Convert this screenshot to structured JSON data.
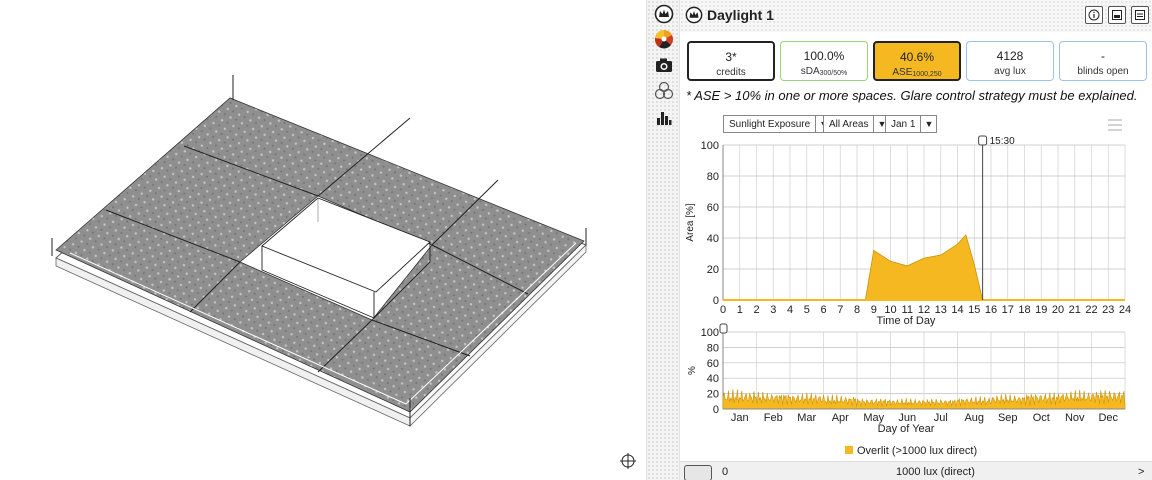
{
  "panel": {
    "title": "Daylight 1",
    "header_buttons": [
      "info-icon",
      "export-image-icon",
      "export-data-icon"
    ]
  },
  "sidebar": {
    "icons": [
      "daylight-logo-icon",
      "sun-rays-icon",
      "camera-icon",
      "shapes-icon",
      "bar-chart-icon"
    ]
  },
  "metrics": [
    {
      "value": "3*",
      "label": "credits",
      "border": "#222222",
      "bg": "#ffffff"
    },
    {
      "value": "100.0%",
      "label": "sDA",
      "sub": "300/50%",
      "border": "#9bd37a",
      "bg": "#ffffff"
    },
    {
      "value": "40.6%",
      "label": "ASE",
      "sub": "1000,250",
      "border": "#222222",
      "bg": "#f5b820"
    },
    {
      "value": "4128",
      "label": "avg lux",
      "border": "#9cc3e6",
      "bg": "#ffffff"
    },
    {
      "value": "-",
      "label": "blinds open",
      "border": "#9cc3e6",
      "bg": "#ffffff"
    }
  ],
  "note": "* ASE > 10% in one or more spaces. Glare control strategy must be explained.",
  "controls": {
    "metric_select": "Sunlight Exposure",
    "area_select": "All Areas",
    "date_select": "Jan 1"
  },
  "colors": {
    "accent": "#f5b820",
    "accent_dark": "#c8940a"
  },
  "chart_data": [
    {
      "type": "area",
      "ylabel": "Area [%]",
      "xlabel": "Time of Day",
      "xlim": [
        0,
        24
      ],
      "ylim": [
        0,
        100
      ],
      "yticks": [
        0,
        20,
        40,
        60,
        80,
        100
      ],
      "xticks": [
        0,
        1,
        2,
        3,
        4,
        5,
        6,
        7,
        8,
        9,
        10,
        11,
        12,
        13,
        14,
        15,
        16,
        17,
        18,
        19,
        20,
        21,
        22,
        23,
        24
      ],
      "marker_label": "15:30",
      "marker_x": 15.5,
      "grid": true,
      "x": [
        8.5,
        9,
        10,
        11,
        12,
        13,
        14,
        14.5,
        15,
        15.5
      ],
      "y": [
        0,
        32,
        25,
        22,
        27,
        29,
        36,
        42,
        23,
        0
      ]
    },
    {
      "type": "area",
      "ylabel": "%",
      "xlabel": "Day of Year",
      "ylim": [
        0,
        100
      ],
      "yticks": [
        0,
        20,
        40,
        60,
        80,
        100
      ],
      "months": [
        "Jan",
        "Feb",
        "Mar",
        "Apr",
        "May",
        "Jun",
        "Jul",
        "Aug",
        "Sep",
        "Oct",
        "Nov",
        "Dec"
      ],
      "legend": "Overlit (>1000 lux direct)",
      "legend_position": "bottom",
      "grid": true,
      "monthly_peak": [
        26,
        23,
        22,
        19,
        15,
        14,
        14,
        17,
        20,
        23,
        25,
        27
      ],
      "monthly_low": [
        4,
        5,
        4,
        3,
        3,
        3,
        3,
        3,
        4,
        4,
        5,
        5
      ]
    }
  ],
  "bottom": {
    "left_value": "0",
    "center_value": "1000 lux (direct)",
    "right_arrow": ">"
  }
}
